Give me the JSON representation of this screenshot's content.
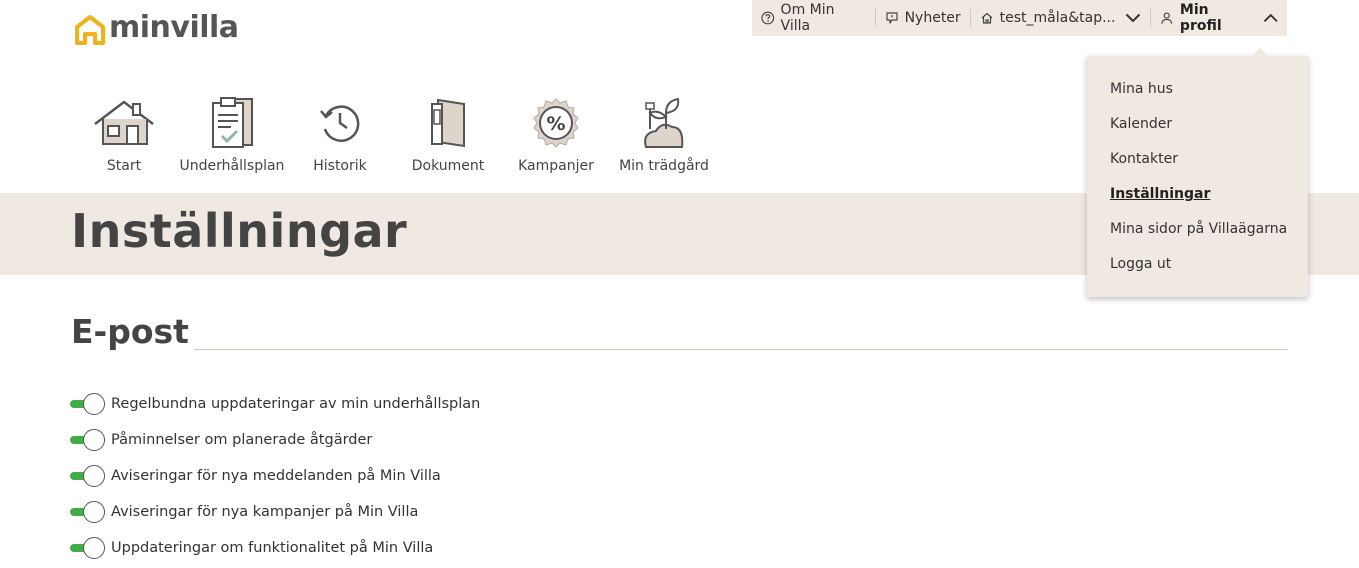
{
  "brand": {
    "name": "minvilla",
    "accent": "#f2b31a"
  },
  "topbar": {
    "about_label": "Om Min Villa",
    "news_label": "Nyheter",
    "house_label": "test_måla&tap...",
    "profile_label": "Min profil"
  },
  "nav": [
    {
      "label": "Start",
      "icon": "house-icon"
    },
    {
      "label": "Underhållsplan",
      "icon": "document-check-icon"
    },
    {
      "label": "Historik",
      "icon": "history-icon"
    },
    {
      "label": "Dokument",
      "icon": "book-icon"
    },
    {
      "label": "Kampanjer",
      "icon": "percent-badge-icon"
    },
    {
      "label": "Min trädgård",
      "icon": "garden-icon"
    }
  ],
  "page": {
    "title": "Inställningar"
  },
  "email_section": {
    "title": "E-post",
    "settings": [
      {
        "label": "Regelbundna uppdateringar av min underhållsplan",
        "enabled": true
      },
      {
        "label": "Påminnelser om planerade åtgärder",
        "enabled": true
      },
      {
        "label": "Aviseringar för nya meddelanden på Min Villa",
        "enabled": true
      },
      {
        "label": "Aviseringar för nya kampanjer på Min Villa",
        "enabled": true
      },
      {
        "label": "Uppdateringar om funktionalitet på Min Villa",
        "enabled": true
      }
    ]
  },
  "profile_menu": {
    "items": [
      {
        "label": "Mina hus"
      },
      {
        "label": "Kalender"
      },
      {
        "label": "Kontakter"
      },
      {
        "label": "Inställningar",
        "active": true
      },
      {
        "label": "Mina sidor på Villaägarna"
      },
      {
        "label": "Logga ut"
      }
    ]
  },
  "colors": {
    "band": "#efe9e2",
    "toggle_on": "#41ad49",
    "text": "#3a3a3a"
  }
}
